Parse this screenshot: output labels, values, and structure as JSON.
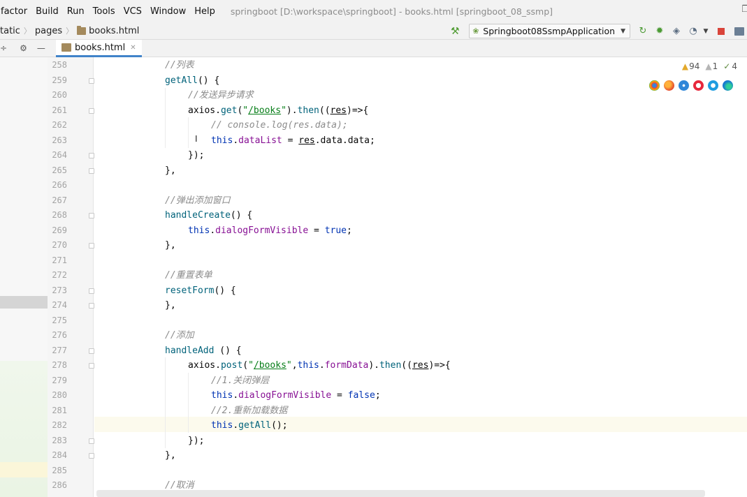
{
  "menu": {
    "items": [
      "factor",
      "Build",
      "Run",
      "Tools",
      "VCS",
      "Window",
      "Help"
    ],
    "title": "springboot [D:\\workspace\\springboot] - books.html [springboot_08_ssmp]"
  },
  "breadcrumb": {
    "items": [
      "tatic",
      "pages",
      "books.html"
    ]
  },
  "run_config": {
    "label": "Springboot08SsmpApplication"
  },
  "editor": {
    "tab_label": "books.html",
    "inspections": {
      "warnings": "94",
      "weak_warnings": "1",
      "typos": "4"
    }
  },
  "code": {
    "line_numbers": [
      "258",
      "259",
      "260",
      "261",
      "262",
      "263",
      "264",
      "265",
      "266",
      "267",
      "268",
      "269",
      "270",
      "271",
      "272",
      "273",
      "274",
      "275",
      "276",
      "277",
      "278",
      "279",
      "280",
      "281",
      "282",
      "283",
      "284",
      "285",
      "286"
    ],
    "lines": [
      [
        {
          "t": "//列表",
          "c": "cmt"
        }
      ],
      [
        {
          "t": "getAll",
          "c": "fn"
        },
        {
          "t": "() {",
          "c": "plain"
        }
      ],
      [
        {
          "t": "//发送异步请求",
          "c": "cmt"
        }
      ],
      [
        {
          "t": "axios.",
          "c": "plain"
        },
        {
          "t": "get",
          "c": "fn"
        },
        {
          "t": "(",
          "c": "plain"
        },
        {
          "t": "\"",
          "c": "str"
        },
        {
          "t": "/books",
          "c": "strlink"
        },
        {
          "t": "\"",
          "c": "str"
        },
        {
          "t": ").",
          "c": "plain"
        },
        {
          "t": "then",
          "c": "fn"
        },
        {
          "t": "((",
          "c": "plain"
        },
        {
          "t": "res",
          "c": "param"
        },
        {
          "t": ")=>{",
          "c": "plain"
        }
      ],
      [
        {
          "t": "// console.log(res.data);",
          "c": "cmt"
        }
      ],
      [
        {
          "t": "this",
          "c": "kw"
        },
        {
          "t": ".",
          "c": "plain"
        },
        {
          "t": "dataList",
          "c": "prop"
        },
        {
          "t": " = ",
          "c": "plain"
        },
        {
          "t": "res",
          "c": "param"
        },
        {
          "t": ".data.data;",
          "c": "plain"
        }
      ],
      [
        {
          "t": "});",
          "c": "plain"
        }
      ],
      [
        {
          "t": "},",
          "c": "plain"
        }
      ],
      [],
      [
        {
          "t": "//弹出添加窗口",
          "c": "cmt"
        }
      ],
      [
        {
          "t": "handleCreate",
          "c": "fn"
        },
        {
          "t": "() {",
          "c": "plain"
        }
      ],
      [
        {
          "t": "this",
          "c": "kw"
        },
        {
          "t": ".",
          "c": "plain"
        },
        {
          "t": "dialogFormVisible",
          "c": "prop"
        },
        {
          "t": " = ",
          "c": "plain"
        },
        {
          "t": "true",
          "c": "kw"
        },
        {
          "t": ";",
          "c": "plain"
        }
      ],
      [
        {
          "t": "},",
          "c": "plain"
        }
      ],
      [],
      [
        {
          "t": "//重置表单",
          "c": "cmt"
        }
      ],
      [
        {
          "t": "resetForm",
          "c": "fn"
        },
        {
          "t": "() {",
          "c": "plain"
        }
      ],
      [
        {
          "t": "},",
          "c": "plain"
        }
      ],
      [],
      [
        {
          "t": "//添加",
          "c": "cmt"
        }
      ],
      [
        {
          "t": "handleAdd",
          "c": "fn"
        },
        {
          "t": " () {",
          "c": "plain"
        }
      ],
      [
        {
          "t": "axios.",
          "c": "plain"
        },
        {
          "t": "post",
          "c": "fn"
        },
        {
          "t": "(",
          "c": "plain"
        },
        {
          "t": "\"",
          "c": "str"
        },
        {
          "t": "/books",
          "c": "strlink"
        },
        {
          "t": "\"",
          "c": "str"
        },
        {
          "t": ",",
          "c": "plain"
        },
        {
          "t": "this",
          "c": "kw"
        },
        {
          "t": ".",
          "c": "plain"
        },
        {
          "t": "formData",
          "c": "prop"
        },
        {
          "t": ").",
          "c": "plain"
        },
        {
          "t": "then",
          "c": "fn"
        },
        {
          "t": "((",
          "c": "plain"
        },
        {
          "t": "res",
          "c": "param"
        },
        {
          "t": ")=>{",
          "c": "plain"
        }
      ],
      [
        {
          "t": "//1.关闭弹层",
          "c": "cmt"
        }
      ],
      [
        {
          "t": "this",
          "c": "kw"
        },
        {
          "t": ".",
          "c": "plain"
        },
        {
          "t": "dialogFormVisible",
          "c": "prop"
        },
        {
          "t": " = ",
          "c": "plain"
        },
        {
          "t": "false",
          "c": "kw"
        },
        {
          "t": ";",
          "c": "plain"
        }
      ],
      [
        {
          "t": "//2.重新加载数据",
          "c": "cmt"
        }
      ],
      [
        {
          "t": "this",
          "c": "kw"
        },
        {
          "t": ".",
          "c": "plain"
        },
        {
          "t": "getAll",
          "c": "fn"
        },
        {
          "t": "();",
          "c": "plain"
        }
      ],
      [
        {
          "t": "});",
          "c": "plain"
        }
      ],
      [
        {
          "t": "},",
          "c": "plain"
        }
      ],
      [],
      [
        {
          "t": "//取消",
          "c": "cmt"
        }
      ]
    ],
    "colors": {
      "comment": "#8c8c8c",
      "function": "#00627a",
      "keyword": "#0033b3",
      "string": "#067d17",
      "property": "#871094"
    }
  },
  "icons": {
    "menubar_right": "restore-window-icon",
    "nav": [
      "hammer-icon",
      "rerun-icon",
      "debug-icon",
      "coverage-icon",
      "profiler-icon",
      "stop-icon",
      "project-structure-icon"
    ],
    "tab_toolbar": [
      "collapse-icon",
      "gear-icon",
      "hide-icon"
    ],
    "browsers": [
      "chrome-icon",
      "firefox-icon",
      "safari-icon",
      "opera-icon",
      "ie-icon",
      "edge-icon"
    ]
  }
}
